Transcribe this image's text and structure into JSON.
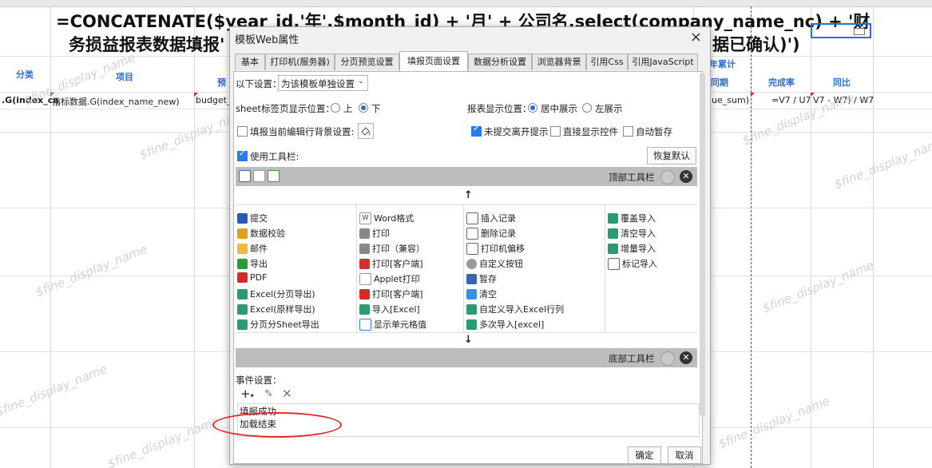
{
  "sheet": {
    "formula_line1": "=CONCATENATE($year_id,'年',$month_id) + '月' + 公司名.select(company_name_nc) + '财",
    "formula_line2_left": "务损益报表数据填报'",
    "formula_line2_right": "据已确认)')",
    "headers": {
      "category": "分类",
      "item": "项目",
      "budget_short": "预",
      "ytd": "年累计",
      "same_period": "同期",
      "completion_rate": "完成率",
      "yoy": "同比"
    },
    "row": {
      "cell_a": ".G(index_ca",
      "cell_b": "指标数据.G(index_name_new)",
      "cell_c": "budget_",
      "cell_d": "lue_sum)",
      "cell_e": "=V7 / U7",
      "cell_f": "V7 - W7) / W7"
    },
    "watermark": "$fine_display_name",
    "accent_color": "#2f6fc4",
    "selection_color": "#2a6fd6"
  },
  "dialog": {
    "title": "模板Web属性",
    "close_icon": "×",
    "tabs": [
      "基本",
      "打印机(服务器)",
      "分页预览设置",
      "填报页面设置",
      "数据分析设置",
      "浏览器背景",
      "引用Css",
      "引用JavaScript"
    ],
    "active_tab": "填报页面设置",
    "settings_label": "以下设置：",
    "settings_value": "为该模板单独设置",
    "sheet_pos_label": "sheet标签页显示位置：",
    "sheet_pos_top": "上",
    "sheet_pos_bottom": "下",
    "report_pos_label": "报表显示位置：",
    "report_pos_center": "居中展示",
    "report_pos_left": "左展示",
    "fill_bg_label": "填报当前编辑行背景设置:",
    "unsubmitted_label": "未提交离开提示",
    "direct_control_label": "直接显示控件",
    "autosave_label": "自动暂存",
    "use_toolbar_label": "使用工具栏:",
    "restore_default": "恢复默认",
    "top_toolbar_label": "顶部工具栏",
    "bottom_toolbar_label": "底部工具栏",
    "up_arrow": "↑",
    "down_arrow": "↓",
    "col1": [
      "提交",
      "数据校验",
      "邮件",
      "导出",
      "PDF",
      "Excel(分页导出)",
      "Excel(原样导出)",
      "分页分Sheet导出"
    ],
    "col2": [
      "Word格式",
      "打印",
      "打印（兼容）",
      "打印[客户端]",
      "Applet打印",
      "打印[客户端]",
      "导入[Excel]",
      "显示单元格值"
    ],
    "col3": [
      "插入记录",
      "删除记录",
      "打印机偏移",
      "自定义按钮",
      "暂存",
      "清空",
      "自定义导入Excel行列",
      "多次导入[excel]"
    ],
    "col4": [
      "覆盖导入",
      "清空导入",
      "增量导入",
      "标记导入"
    ],
    "event_label": "事件设置：",
    "events": [
      "填报成功",
      "加载结束"
    ],
    "ok": "确定",
    "cancel": "取消"
  }
}
